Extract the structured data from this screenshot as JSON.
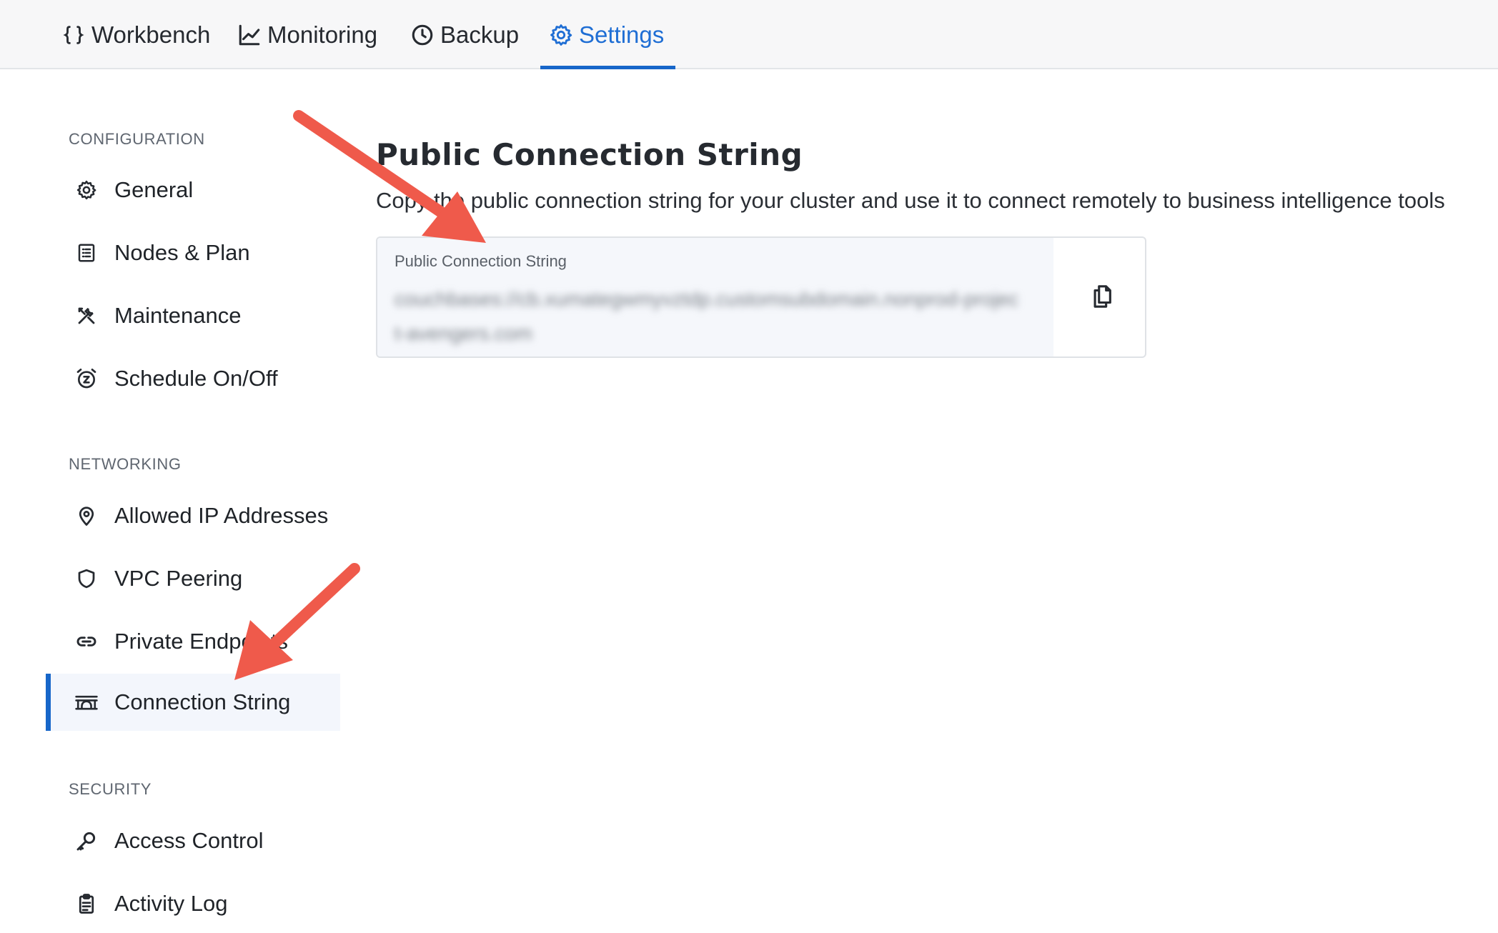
{
  "topnav": {
    "tabs": [
      {
        "label": "Workbench",
        "icon": "braces-icon"
      },
      {
        "label": "Monitoring",
        "icon": "chart-line-icon"
      },
      {
        "label": "Backup",
        "icon": "clock-icon"
      },
      {
        "label": "Settings",
        "icon": "gear-icon"
      }
    ],
    "active_tab": "Settings",
    "accent_color": "#1766c9"
  },
  "sidebar": {
    "sections": [
      {
        "label": "CONFIGURATION",
        "items": [
          {
            "label": "General",
            "icon": "gear-icon"
          },
          {
            "label": "Nodes & Plan",
            "icon": "list-doc-icon"
          },
          {
            "label": "Maintenance",
            "icon": "tools-icon"
          },
          {
            "label": "Schedule On/Off",
            "icon": "alarm-clock-icon"
          }
        ]
      },
      {
        "label": "NETWORKING",
        "items": [
          {
            "label": "Allowed IP Addresses",
            "icon": "location-pin-icon"
          },
          {
            "label": "VPC Peering",
            "icon": "shield-icon"
          },
          {
            "label": "Private Endpoints",
            "icon": "link-icon"
          },
          {
            "label": "Connection String",
            "icon": "bridge-icon"
          }
        ]
      },
      {
        "label": "SECURITY",
        "items": [
          {
            "label": "Access Control",
            "icon": "key-icon"
          },
          {
            "label": "Activity Log",
            "icon": "clipboard-icon"
          }
        ]
      }
    ],
    "active_item": "Connection String"
  },
  "main": {
    "title": "Public Connection String",
    "description": "Copy the public connection string for your cluster and use it to connect remotely to business intelligence tools",
    "connection": {
      "label": "Public Connection String",
      "value": "couchbases://cb.xumategwmyvztdp.customsubdomain.nonprod-project-avengers.com",
      "copy_icon": "copy-icon"
    }
  },
  "annotation_color": "#ef5a4b"
}
